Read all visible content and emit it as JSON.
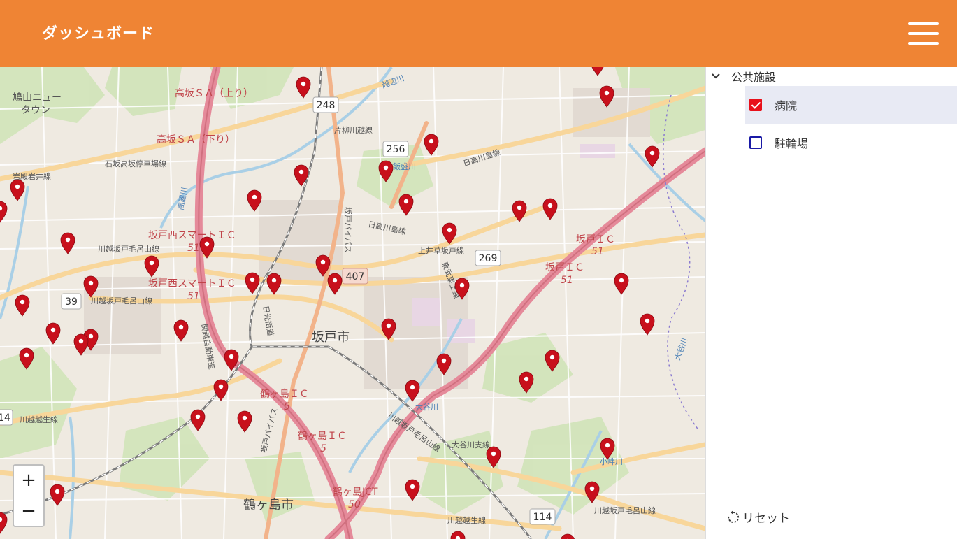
{
  "header": {
    "title": "ダッシュボード",
    "menu_icon": "hamburger-menu-icon"
  },
  "colors": {
    "header": "#ef8434",
    "marker": "#c8101c",
    "checkbox_checked": "#e8101a",
    "checkbox_border": "#1a1aa6"
  },
  "map": {
    "place_labels": [
      "鳩山ニュー",
      "タウン",
      "高坂ＳＡ（上り）",
      "高坂ＳＡ（下り）",
      "石坂高坂停車場線",
      "岩殿岩井線",
      "坂戸西スマートＩＣ",
      "51",
      "坂戸西スマートＩＣ",
      "51",
      "日高川島線",
      "片柳川越線",
      "坂戸市",
      "鶴ヶ島ＩＣ",
      "5",
      "鶴ヶ島ＩＣ",
      "5",
      "鶴ヶ島JCT",
      "50",
      "鶴ヶ島市",
      "坂戸ＩＣ",
      "51",
      "坂戸ＩＣ",
      "51",
      "上井草坂戸線",
      "川越坂戸毛呂山線",
      "川越坂戸毛呂山線",
      "川越越生線",
      "川越越生線",
      "大谷川",
      "大谷川支線",
      "川越坂戸毛呂山線",
      "坂戸バイパス",
      "日光街道",
      "関越自動車道",
      "日高川島線",
      "川越坂戸毛呂山線",
      "小畔川",
      "高麗川",
      "越辺川",
      "飯盛川",
      "大谷川",
      "坂戸バイパス",
      "東武東上線"
    ],
    "route_shields": [
      "248",
      "256",
      "269",
      "407",
      "39",
      "114",
      "14"
    ]
  },
  "zoom": {
    "in_label": "+",
    "out_label": "−"
  },
  "sidebar": {
    "group": {
      "label": "公共施設",
      "expanded": true
    },
    "items": [
      {
        "label": "病院",
        "checked": true
      },
      {
        "label": "駐輪場",
        "checked": false
      }
    ],
    "reset_label": "リセット"
  }
}
